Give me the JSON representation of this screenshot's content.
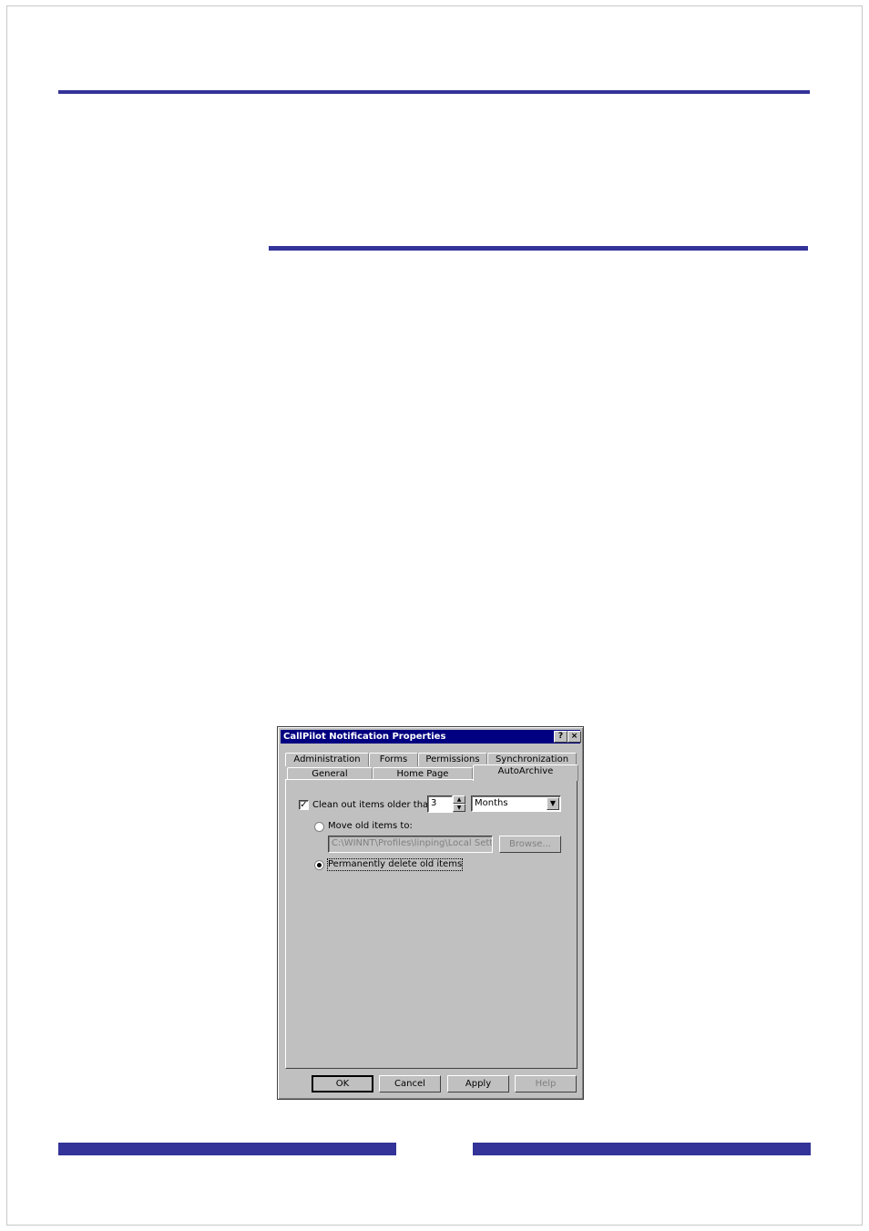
{
  "dialog": {
    "title": "CallPilot Notification Properties",
    "help_glyph": "?",
    "close_glyph": "×"
  },
  "tabs": {
    "row1": [
      "Administration",
      "Forms",
      "Permissions",
      "Synchronization"
    ],
    "row2": [
      "General",
      "Home Page",
      "AutoArchive"
    ],
    "active": "AutoArchive"
  },
  "autoarchive": {
    "clean_out_checked": true,
    "clean_out_label": "Clean out items older than",
    "age_value": "3",
    "age_unit": "Months",
    "move_label": "Move old items to:",
    "move_selected": false,
    "move_path": "C:\\WINNT\\Profiles\\linping\\Local Settings",
    "browse_label": "Browse...",
    "delete_label": "Permanently delete old items",
    "delete_selected": true
  },
  "buttons": {
    "ok": "OK",
    "cancel": "Cancel",
    "apply": "Apply",
    "help": "Help"
  },
  "colors": {
    "rule": "#333399",
    "titlebar": "#000080",
    "dialog_face": "#c0c0c0"
  }
}
